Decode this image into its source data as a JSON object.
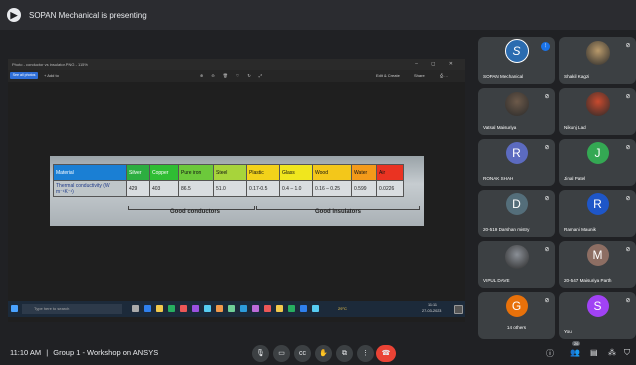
{
  "banner": {
    "presenting_text": "SOPAN Mechanical is presenting"
  },
  "screen": {
    "window_title": "Photo - conductor vs insulator.PNG - 115%",
    "window_controls": "– ◻ ✕",
    "toolbar": {
      "see_all_photos": "See all photos",
      "add_to": "+ Add to",
      "edit_create": "Edit & Create",
      "share": "Share"
    },
    "table": {
      "header_label": "Material",
      "row_label": "Thermal conductivity (W m⁻¹K⁻¹)",
      "columns": [
        {
          "name": "Silver",
          "value": "429"
        },
        {
          "name": "Copper",
          "value": "403"
        },
        {
          "name": "Pure iron",
          "value": "86.5"
        },
        {
          "name": "Steel",
          "value": "51.0"
        },
        {
          "name": "Plastic",
          "value": "0.17-0.5"
        },
        {
          "name": "Glass",
          "value": "0.4 – 1.0"
        },
        {
          "name": "Wood",
          "value": "0.16 – 0.25"
        },
        {
          "name": "Water",
          "value": "0.599"
        },
        {
          "name": "Air",
          "value": "0.0226"
        }
      ],
      "good_conductors": "Good conductors",
      "good_insulators": "Good insulators"
    },
    "taskbar": {
      "search_placeholder": "Type here to search",
      "weather": "29°C",
      "time": "11:11",
      "date": "27-03-2023"
    }
  },
  "participants": [
    {
      "name": "SOPAN Mechanical",
      "type": "logo",
      "color": "#2b6cb0"
    },
    {
      "name": "Shakil Kagzi",
      "type": "photo",
      "color": "#b99a6b"
    },
    {
      "name": "Vatsal Maisuriya",
      "type": "photo",
      "color": "#6d5a4a"
    },
    {
      "name": "Nikunj Lad",
      "type": "photo",
      "color": "#c84a2e"
    },
    {
      "name": "RONAK SHAH",
      "type": "initial",
      "initial": "R",
      "color": "#5c6bc0"
    },
    {
      "name": "Jinal Patel",
      "type": "initial",
      "initial": "J",
      "color": "#34a853"
    },
    {
      "name": "20-519 Darshan mistry",
      "type": "initial",
      "initial": "D",
      "color": "#546e7a"
    },
    {
      "name": "Ramani Maunik",
      "type": "initial",
      "initial": "R",
      "color": "#1e56c8"
    },
    {
      "name": "VIPUL DAVE",
      "type": "photo",
      "color": "#8a8f96"
    },
    {
      "name": "20-547 Maisuriya Parth",
      "type": "initial",
      "initial": "M",
      "color": "#8d6e63"
    },
    {
      "name": "14 others",
      "type": "others",
      "initial": "G",
      "color": "#e8710a"
    },
    {
      "name": "You",
      "type": "initial",
      "initial": "S",
      "color": "#a142f4"
    }
  ],
  "bottom_bar": {
    "time": "11:10 AM",
    "separator": "|",
    "meeting_name": "Group 1 - Workshop on ANSYS",
    "people_count": "26"
  }
}
